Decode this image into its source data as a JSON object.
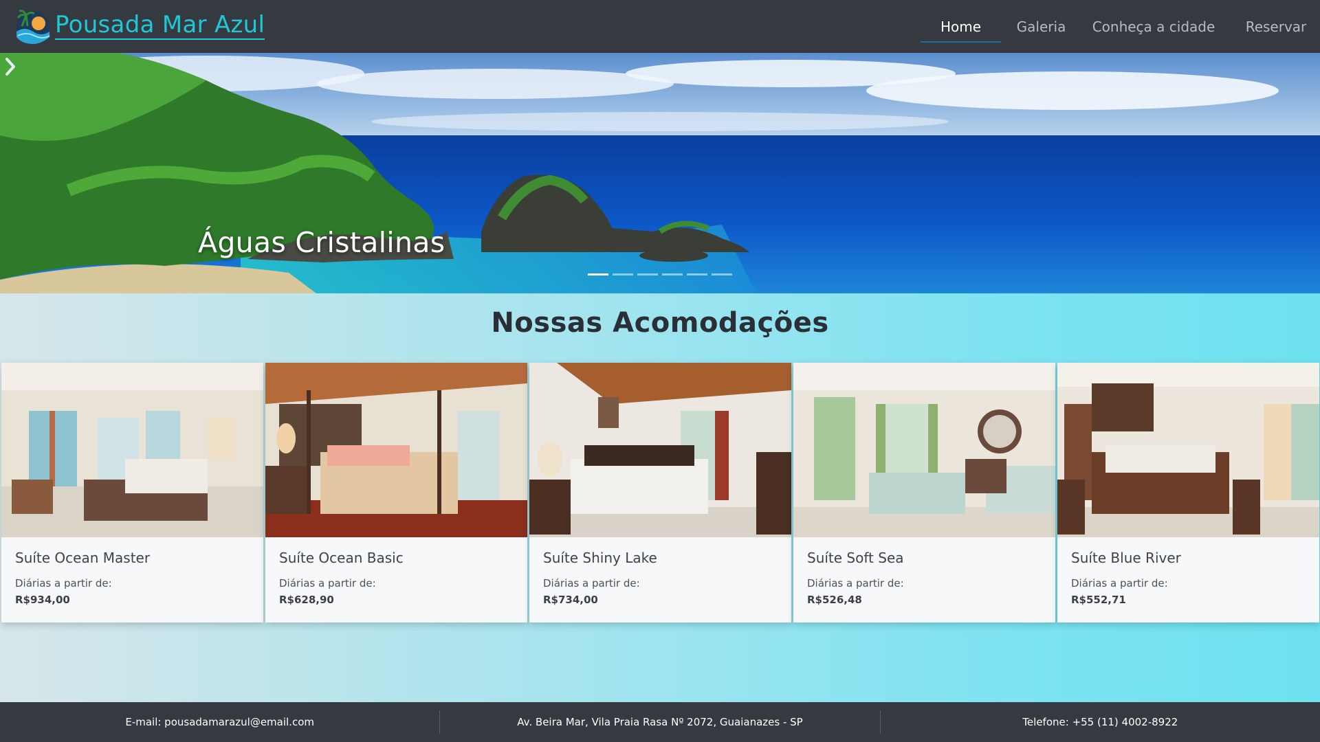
{
  "brand": {
    "name": "Pousada Mar Azul",
    "logo_icon": "sun-wave-logo"
  },
  "nav": {
    "items": [
      {
        "label": "Home",
        "active": true
      },
      {
        "label": "Galeria",
        "active": false
      },
      {
        "label": "Conheça a cidade",
        "active": false
      },
      {
        "label": "Reservar",
        "active": false
      }
    ]
  },
  "hero": {
    "caption": "Águas Cristalinas",
    "next_icon": "chevron-right-icon",
    "slides_count": 6,
    "active_slide": 1
  },
  "main": {
    "title": "Nossas Acomodações",
    "price_label": "Diárias a partir de:",
    "cards": [
      {
        "title": "Suíte Ocean Master",
        "price": "R$934,00"
      },
      {
        "title": "Suíte Ocean Basic",
        "price": "R$628,90"
      },
      {
        "title": "Suíte Shiny Lake",
        "price": "R$734,00"
      },
      {
        "title": "Suíte Soft Sea",
        "price": "R$526,48"
      },
      {
        "title": "Suíte Blue River",
        "price": "R$552,71"
      }
    ]
  },
  "footer": {
    "email": "E-mail: pousadamarazul@email.com",
    "address": "Av. Beira Mar, Vila Praia Rasa Nº 2072, Guaianazes - SP",
    "phone": "Telefone: +55 (11) 4002-8922"
  },
  "colors": {
    "navbar_bg": "#343a40",
    "brand": "#1ec8d6",
    "nav_active_underline": "#1f6f9a",
    "main_gradient_start": "#d6e6ea",
    "main_gradient_end": "#6de1ef"
  }
}
